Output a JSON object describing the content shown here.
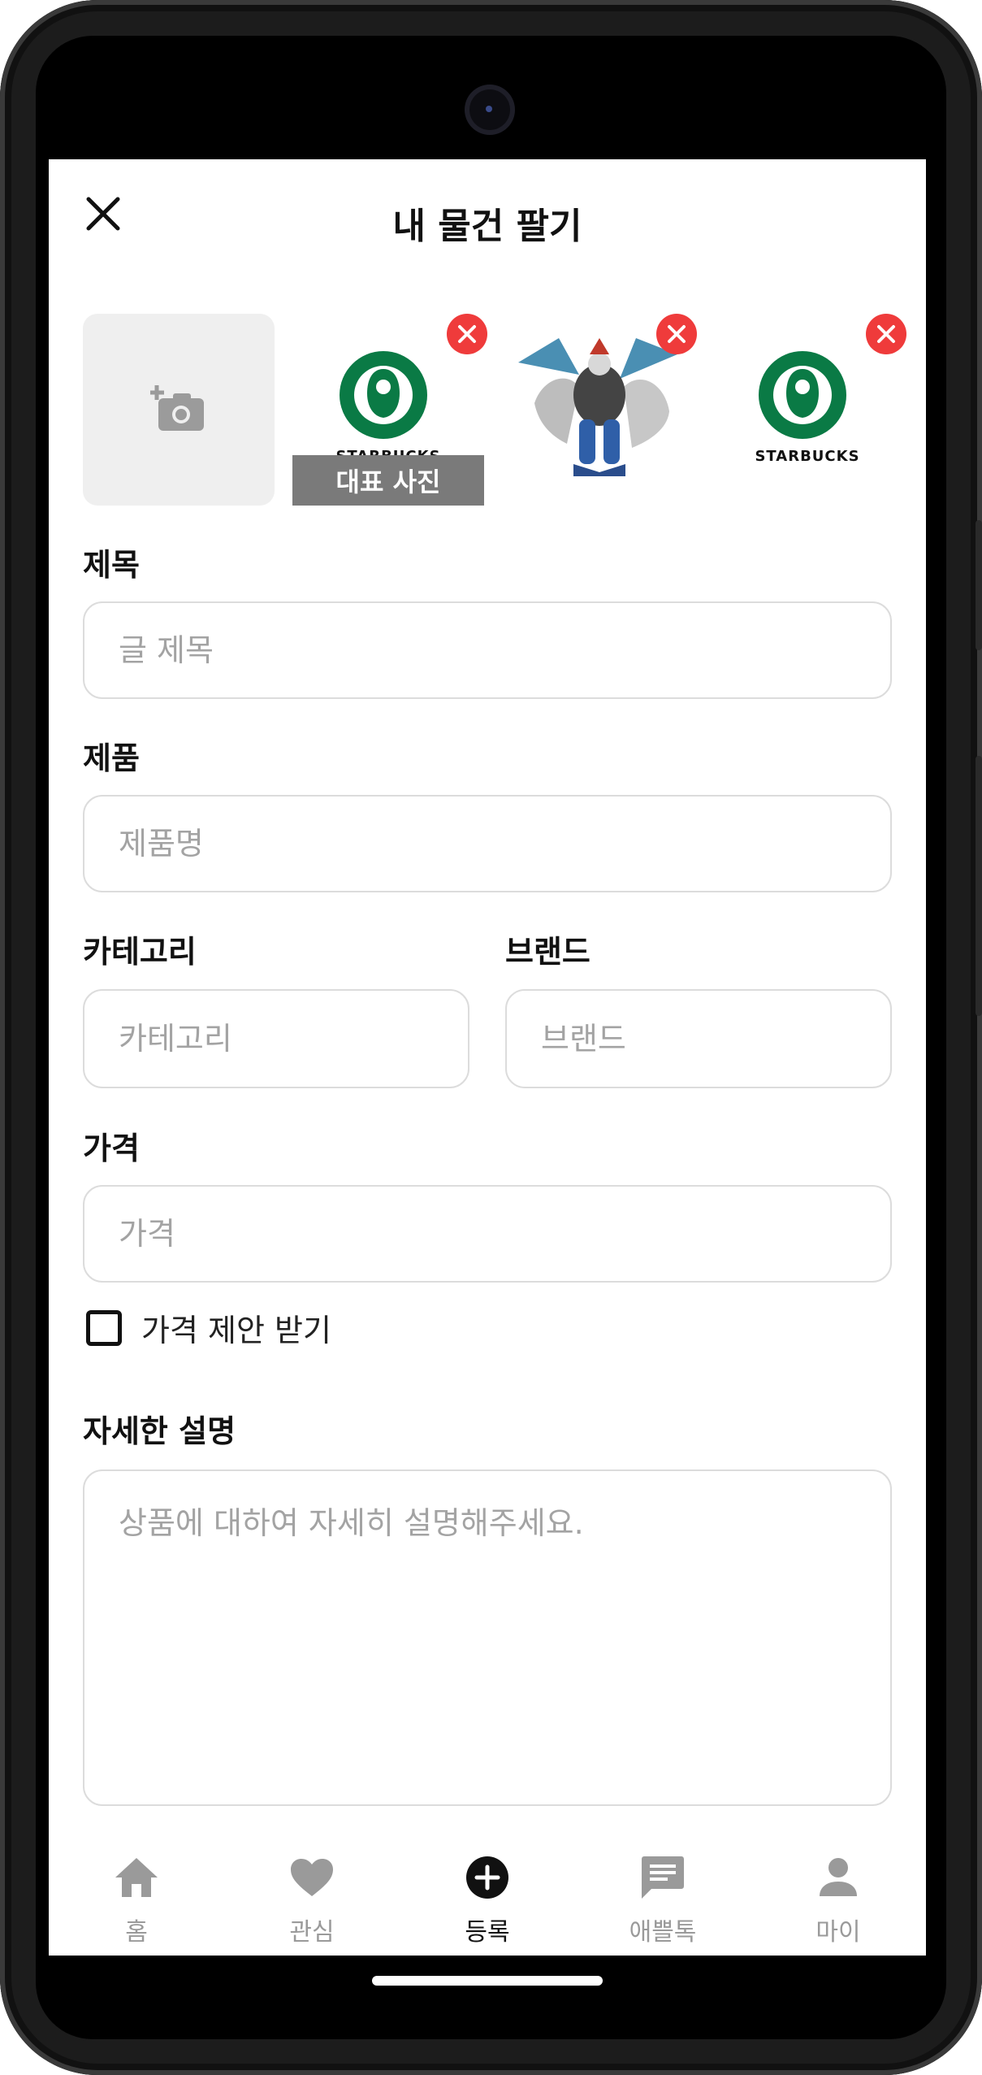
{
  "header": {
    "title": "내 물건 팔기",
    "close_icon": "close-icon"
  },
  "photos": {
    "add_icon": "add-photo-icon",
    "representative_label": "대표 사진",
    "items": [
      {
        "name": "starbucks-logo",
        "caption": "STARBUCKS"
      },
      {
        "name": "digimon-figure"
      },
      {
        "name": "starbucks-logo",
        "caption": "STARBUCKS"
      }
    ],
    "remove_color": "#ef3b3b"
  },
  "form": {
    "title_label": "제목",
    "title_placeholder": "글 제목",
    "product_label": "제품",
    "product_placeholder": "제품명",
    "category_label": "카테고리",
    "category_placeholder": "카테고리",
    "brand_label": "브랜드",
    "brand_placeholder": "브랜드",
    "price_label": "가격",
    "price_placeholder": "가격",
    "price_offer_label": "가격 제안 받기",
    "description_label": "자세한 설명",
    "description_placeholder": "상품에 대하여 자세히 설명해주세요."
  },
  "nav": {
    "items": [
      {
        "label": "홈",
        "icon": "home-icon"
      },
      {
        "label": "관심",
        "icon": "heart-icon"
      },
      {
        "label": "등록",
        "icon": "plus-circle-icon",
        "active": true
      },
      {
        "label": "애쁠톡",
        "icon": "chat-icon"
      },
      {
        "label": "마이",
        "icon": "person-icon"
      }
    ],
    "active_color": "#111111",
    "inactive_color": "#9a9a9a"
  }
}
